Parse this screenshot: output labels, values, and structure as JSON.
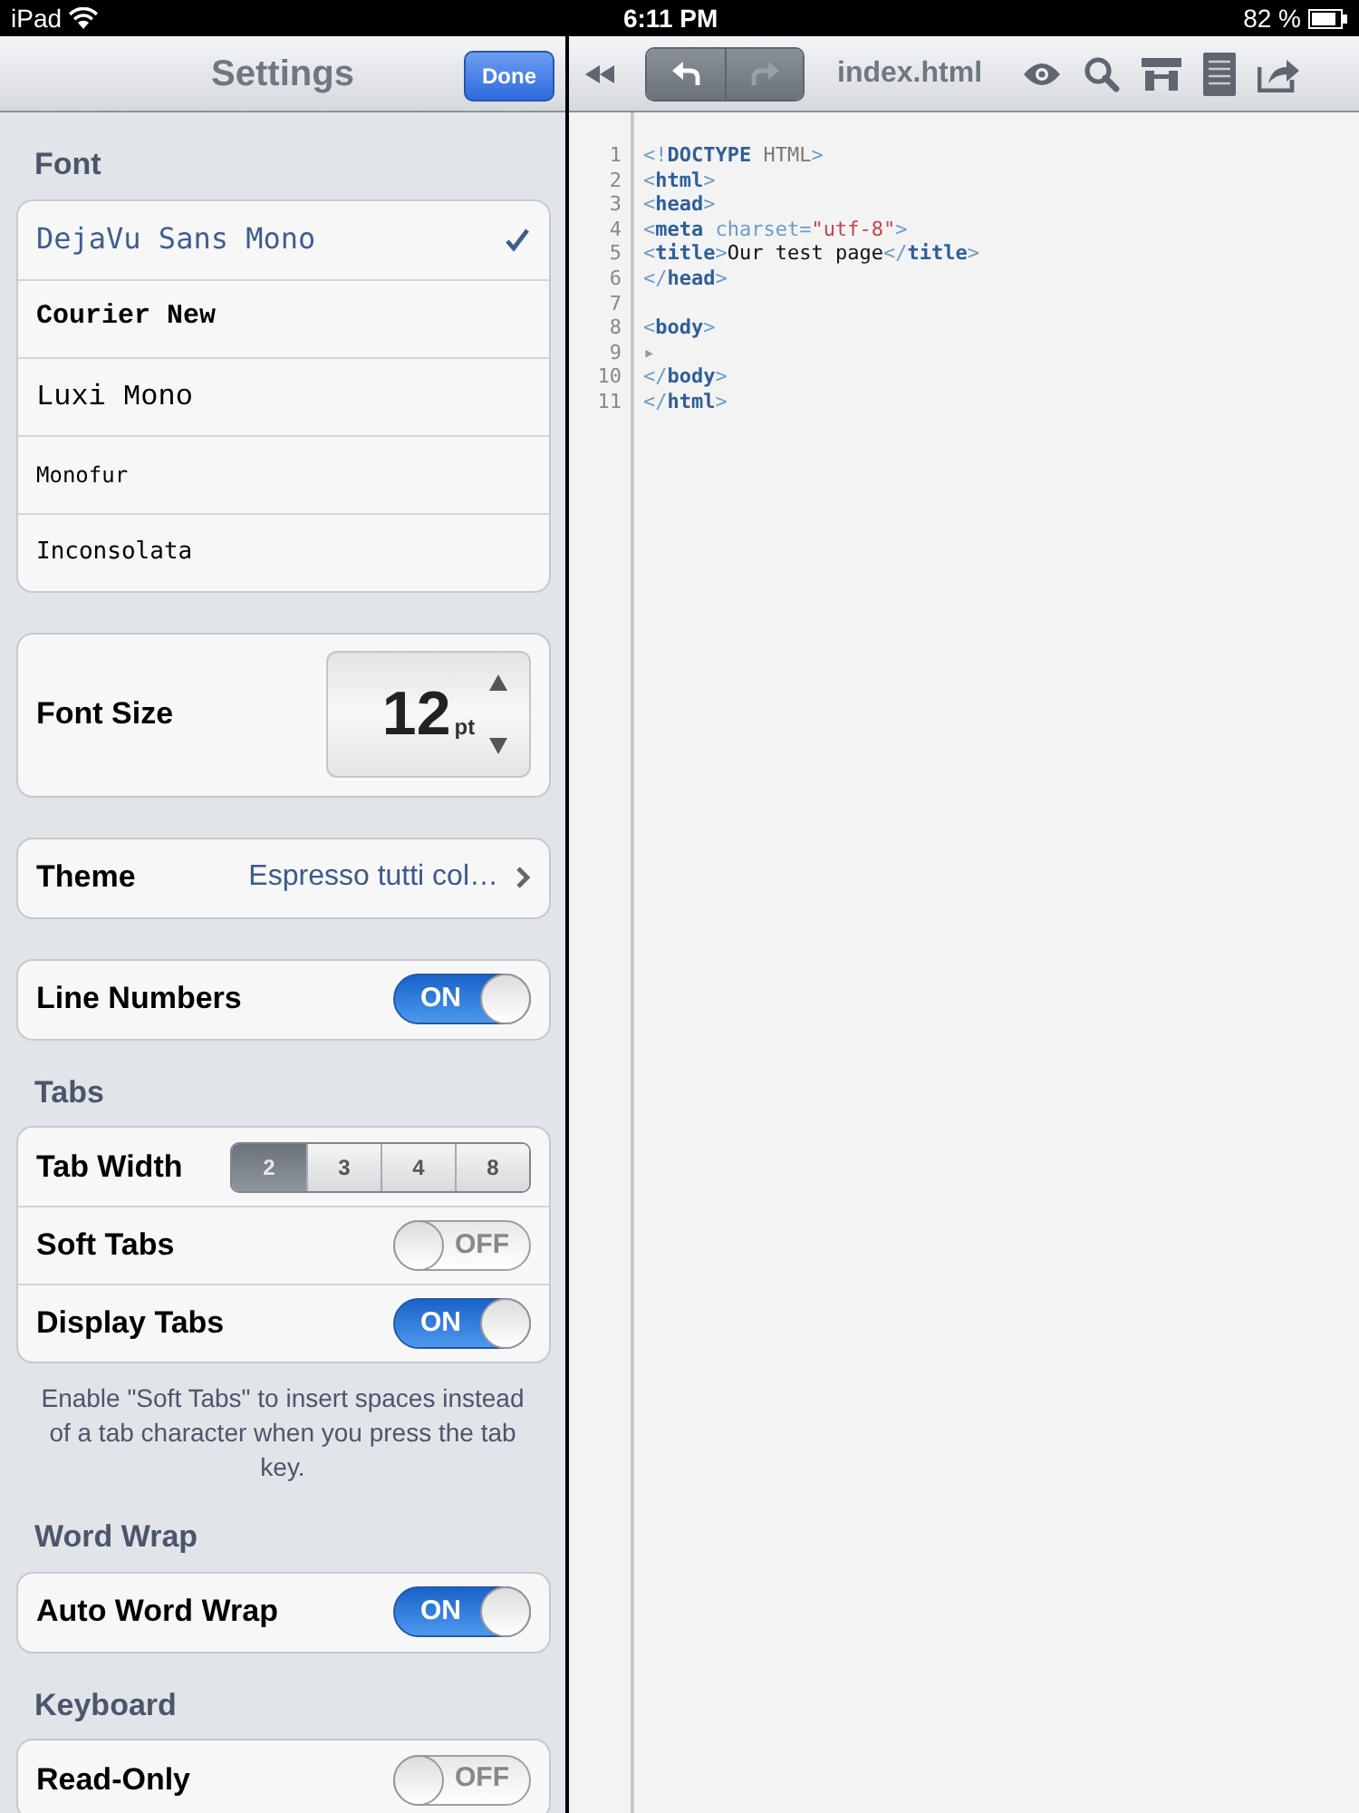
{
  "status_bar": {
    "device": "iPad",
    "time": "6:11 PM",
    "battery": "82 %"
  },
  "settings": {
    "title": "Settings",
    "done": "Done",
    "sections": [
      {
        "header": "Font",
        "rows": [
          {
            "kind": "choice",
            "label": "DejaVu Sans Mono",
            "selected": true
          },
          {
            "kind": "choice",
            "label": "Courier New",
            "selected": false
          },
          {
            "kind": "choice",
            "label": "Luxi Mono",
            "selected": false
          },
          {
            "kind": "choice",
            "label": "Monofur",
            "selected": false
          },
          {
            "kind": "choice",
            "label": "Inconsolata",
            "selected": false
          }
        ]
      },
      {
        "rows": [
          {
            "kind": "stepper",
            "label": "Font Size",
            "value": "12",
            "unit": "pt"
          }
        ]
      },
      {
        "rows": [
          {
            "kind": "disclosure",
            "label": "Theme",
            "value": "Espresso tutti col…"
          }
        ]
      },
      {
        "rows": [
          {
            "kind": "toggle",
            "label": "Line Numbers",
            "on": true,
            "switch_text": "ON"
          }
        ]
      },
      {
        "header": "Tabs",
        "rows": [
          {
            "kind": "segmented",
            "label": "Tab Width",
            "options": [
              {
                "label": "2",
                "selected": true
              },
              {
                "label": "3",
                "selected": false
              },
              {
                "label": "4",
                "selected": false
              },
              {
                "label": "8",
                "selected": false
              }
            ]
          },
          {
            "kind": "toggle",
            "label": "Soft Tabs",
            "on": false,
            "switch_text": "OFF"
          },
          {
            "kind": "toggle",
            "label": "Display Tabs",
            "on": true,
            "switch_text": "ON"
          }
        ],
        "footer": "Enable \"Soft Tabs\" to insert spaces instead of a tab character when you press the tab key."
      },
      {
        "header": "Word Wrap",
        "rows": [
          {
            "kind": "toggle",
            "label": "Auto Word Wrap",
            "on": true,
            "switch_text": "ON"
          }
        ]
      },
      {
        "header": "Keyboard",
        "rows": [
          {
            "kind": "toggle",
            "label": "Read-Only",
            "on": false,
            "switch_text": "OFF"
          }
        ]
      }
    ]
  },
  "editor": {
    "file": "index.html",
    "undo": {
      "disabled": false
    },
    "redo": {
      "disabled": true
    },
    "lines": [
      {
        "number": "1",
        "tokens": [
          {
            "kind": "punct",
            "text": "<!"
          },
          {
            "kind": "tag",
            "text": "DOCTYPE"
          },
          {
            "kind": "plain",
            "text": " HTML"
          },
          {
            "kind": "punct",
            "text": ">"
          }
        ]
      },
      {
        "number": "2",
        "tokens": [
          {
            "kind": "punct",
            "text": "<"
          },
          {
            "kind": "tag",
            "text": "html"
          },
          {
            "kind": "punct",
            "text": ">"
          }
        ]
      },
      {
        "number": "3",
        "tokens": [
          {
            "kind": "punct",
            "text": "<"
          },
          {
            "kind": "tag",
            "text": "head"
          },
          {
            "kind": "punct",
            "text": ">"
          }
        ]
      },
      {
        "number": "4",
        "tokens": [
          {
            "kind": "punct",
            "text": "<"
          },
          {
            "kind": "tag",
            "text": "meta"
          },
          {
            "kind": "attr",
            "text": " charset"
          },
          {
            "kind": "punct",
            "text": "="
          },
          {
            "kind": "string",
            "text": "\"utf-8\""
          },
          {
            "kind": "punct",
            "text": ">"
          }
        ]
      },
      {
        "number": "5",
        "tokens": [
          {
            "kind": "punct",
            "text": "<"
          },
          {
            "kind": "tag",
            "text": "title"
          },
          {
            "kind": "punct",
            "text": ">"
          },
          {
            "kind": "text",
            "text": "Our test page"
          },
          {
            "kind": "punct",
            "text": "</"
          },
          {
            "kind": "tag",
            "text": "title"
          },
          {
            "kind": "punct",
            "text": ">"
          }
        ]
      },
      {
        "number": "6",
        "tokens": [
          {
            "kind": "punct",
            "text": "</"
          },
          {
            "kind": "tag",
            "text": "head"
          },
          {
            "kind": "punct",
            "text": ">"
          }
        ]
      },
      {
        "number": "7"
      },
      {
        "number": "8",
        "tokens": [
          {
            "kind": "punct",
            "text": "<"
          },
          {
            "kind": "tag",
            "text": "body"
          },
          {
            "kind": "punct",
            "text": ">"
          }
        ]
      },
      {
        "number": "9",
        "tokens": [
          {
            "kind": "tabmark",
            "text": "▸"
          }
        ]
      },
      {
        "number": "10",
        "tokens": [
          {
            "kind": "punct",
            "text": "</"
          },
          {
            "kind": "tag",
            "text": "body"
          },
          {
            "kind": "punct",
            "text": ">"
          }
        ]
      },
      {
        "number": "11",
        "tokens": [
          {
            "kind": "punct",
            "text": "</"
          },
          {
            "kind": "tag",
            "text": "html"
          },
          {
            "kind": "punct",
            "text": ">"
          }
        ]
      }
    ]
  }
}
